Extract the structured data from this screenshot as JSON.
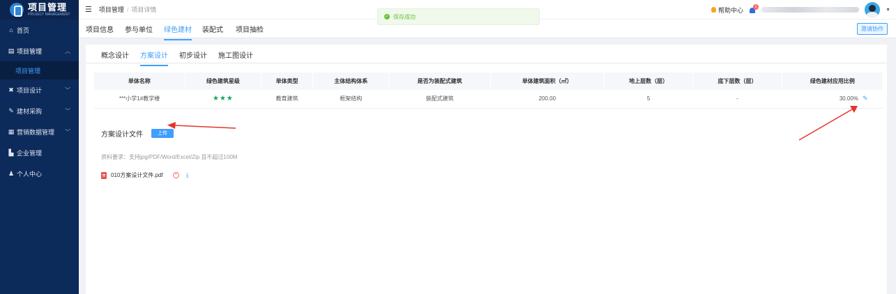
{
  "brand": {
    "title": "项目管理",
    "subtitle": "PROJECT MANAGEMENT"
  },
  "sidebar": {
    "items": [
      {
        "label": "首页",
        "icon": "home-icon"
      },
      {
        "label": "项目管理",
        "icon": "project-icon",
        "expanded": true
      },
      {
        "label": "项目管理",
        "icon": "",
        "sub": true
      },
      {
        "label": "项目设计",
        "icon": "design-icon"
      },
      {
        "label": "建材采购",
        "icon": "purchase-icon"
      },
      {
        "label": "营销数据管理",
        "icon": "data-icon"
      },
      {
        "label": "企业管理",
        "icon": "company-icon"
      },
      {
        "label": "个人中心",
        "icon": "user-icon"
      }
    ]
  },
  "header": {
    "breadcrumb": [
      "项目管理",
      "项目详情"
    ],
    "help_label": "帮助中心",
    "notification_count": "1"
  },
  "toast": {
    "message": "保存成功"
  },
  "tabs": [
    "项目信息",
    "参与单位",
    "绿色建材",
    "装配式",
    "项目抽检"
  ],
  "active_tab": "绿色建材",
  "invite_label": "邀请协作",
  "subtabs": [
    "概念设计",
    "方案设计",
    "初步设计",
    "施工图设计"
  ],
  "active_subtab": "方案设计",
  "table": {
    "headers": [
      "单体名称",
      "绿色建筑星级",
      "单体类型",
      "主体结构体系",
      "是否为装配式建筑",
      "单体建筑面积（㎡）",
      "地上层数（层）",
      "底下层数（层）",
      "绿色建材应用比例"
    ],
    "row": {
      "name": "***小学1#教学楼",
      "stars": "★★★",
      "type": "教育建筑",
      "structure": "框架结构",
      "prefab": "装配式建筑",
      "area": "200.00",
      "floors_above": "5",
      "floors_below": "-",
      "ratio": "30.00%"
    }
  },
  "upload": {
    "label": "方案设计文件",
    "button": "上传",
    "requirement": "资料要求：支持jpg/PDF/Word/Excel/Zip 且不超过100M",
    "file_name": "010方案设计文件.pdf"
  },
  "colors": {
    "sidebar": "#0c2a5a",
    "accent": "#409eff",
    "annotation": "#e8322c",
    "star": "#19a15f"
  }
}
